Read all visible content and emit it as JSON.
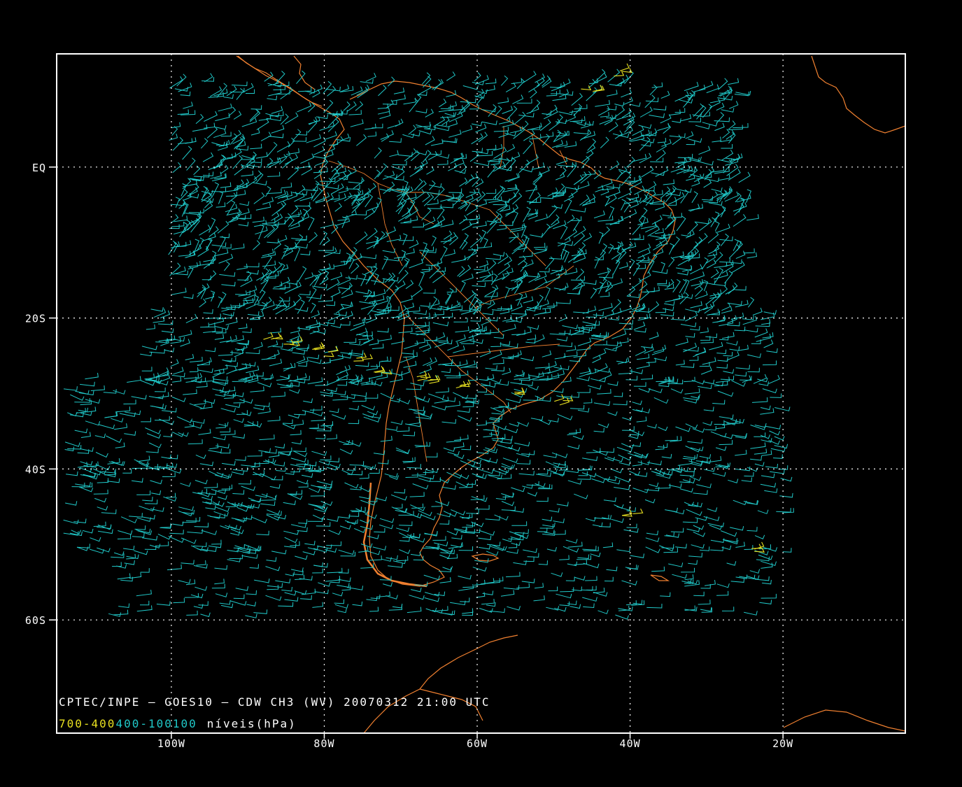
{
  "map": {
    "caption_line1": "CPTEC/INPE — GOES10 — CDW CH3 (WV) 20070312 21:00 UTC",
    "legend": {
      "levels": [
        {
          "label": "700-400",
          "color": "#e8e020"
        },
        {
          "label": "400-100",
          "color": "#20c8c8"
        },
        {
          "label": "100",
          "color": "#20c8c8"
        }
      ],
      "unit_label": "níveis(hPa)"
    },
    "lat_labels": [
      {
        "text": "EQ",
        "lat": 0
      },
      {
        "text": "20S",
        "lat": -20
      },
      {
        "text": "40S",
        "lat": -40
      },
      {
        "text": "60S",
        "lat": -60
      }
    ],
    "lon_labels": [
      {
        "text": "100W",
        "lon": -100
      },
      {
        "text": "80W",
        "lon": -80
      },
      {
        "text": "60W",
        "lon": -60
      },
      {
        "text": "40W",
        "lon": -40
      },
      {
        "text": "20W",
        "lon": -20
      }
    ],
    "extent": {
      "lon_min": -115,
      "lon_max": -4,
      "lat_min": -75,
      "lat_max": 15
    },
    "colors": {
      "background": "#000000",
      "frame": "#ffffff",
      "grid": "#ffffff",
      "coast": "#f08030",
      "wind_high": "#20c8c8",
      "wind_low": "#e8e020"
    }
  }
}
